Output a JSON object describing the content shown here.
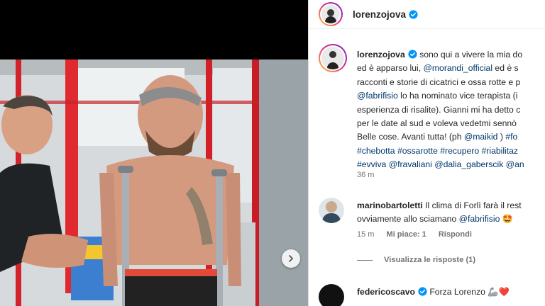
{
  "post": {
    "username": "lorenzojova",
    "caption_lines": [
      {
        "parts": [
          {
            "text": " sono qui a vivere la mia do"
          }
        ]
      },
      {
        "parts": [
          {
            "text": "ed è apparso lui, "
          },
          {
            "text": "@morandi_official",
            "link": true
          },
          {
            "text": " ed è s"
          }
        ]
      },
      {
        "parts": [
          {
            "text": "racconti e storie di cicatrici e ossa rotte e p"
          }
        ]
      },
      {
        "parts": [
          {
            "text": "@fabrifisio",
            "link": true
          },
          {
            "text": " lo ha nominato vice terapista (i"
          }
        ]
      },
      {
        "parts": [
          {
            "text": "esperienza di risalite). Gianni mi ha detto c"
          }
        ]
      },
      {
        "parts": [
          {
            "text": "per le date al sud e voleva vedetmi sennò"
          }
        ]
      },
      {
        "parts": [
          {
            "text": "Belle cose. Avanti tutta! (ph "
          },
          {
            "text": "@maikid",
            "link": true
          },
          {
            "text": " ) "
          },
          {
            "text": "#fo",
            "link": true
          }
        ]
      },
      {
        "parts": [
          {
            "text": "#chebotta",
            "link": true
          },
          {
            "text": " "
          },
          {
            "text": "#ossarotte",
            "link": true
          },
          {
            "text": " "
          },
          {
            "text": "#recupero",
            "link": true
          },
          {
            "text": " "
          },
          {
            "text": "#riabilitaz",
            "link": true
          }
        ]
      },
      {
        "parts": [
          {
            "text": "#evviva",
            "link": true
          },
          {
            "text": " "
          },
          {
            "text": "@fravaliani",
            "link": true
          },
          {
            "text": " "
          },
          {
            "text": "@dalia_gaberscik",
            "link": true
          },
          {
            "text": " "
          },
          {
            "text": "@an",
            "link": true
          }
        ]
      }
    ],
    "time": "36 m"
  },
  "comments": [
    {
      "username": "marinobartoletti",
      "line1": " Il clima di Forlì farà il rest",
      "line2_text": "ovviamente allo sciamano ",
      "line2_link": "@fabrifisio",
      "line2_emoji": " 🤩",
      "time": "15 m",
      "likes": "Mi piace: 1",
      "reply": "Rispondi",
      "view_replies": "Visualizza le risposte (1)"
    },
    {
      "username": "federicoscavo",
      "text": " Forza Lorenzo 🦾❤️"
    }
  ],
  "colors": {
    "link": "#00376b",
    "verified": "#0095f6",
    "muted": "#737373"
  }
}
